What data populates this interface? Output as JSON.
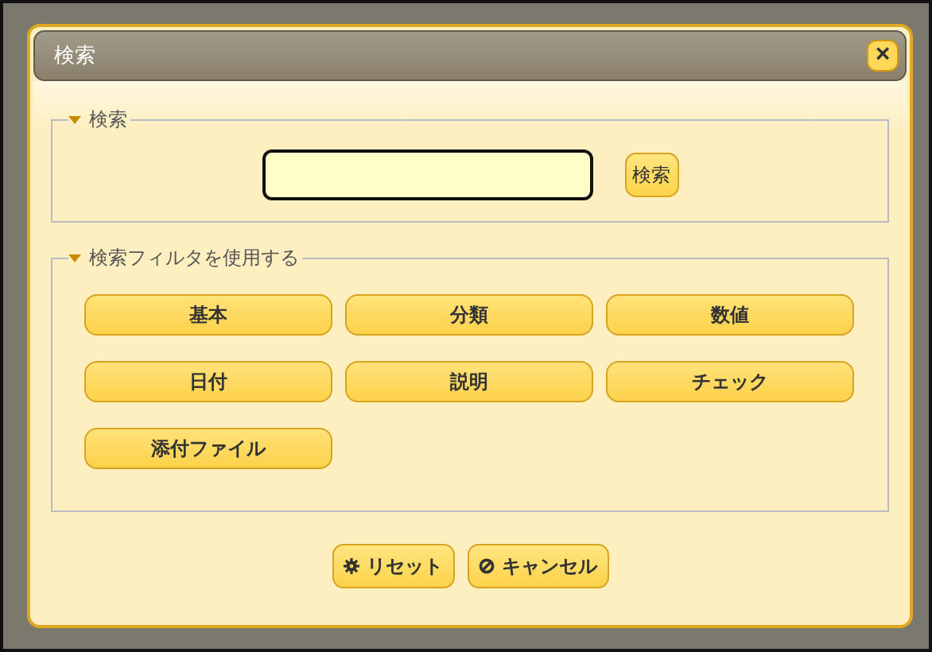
{
  "dialog": {
    "title": "検索",
    "close_icon": "×"
  },
  "search_section": {
    "legend": "検索",
    "expanded": true,
    "button": "検索"
  },
  "filter_section": {
    "legend": "検索フィルタを使用する",
    "expanded": true,
    "buttons": [
      "基本",
      "分類",
      "数値",
      "日付",
      "説明",
      "チェック",
      "添付ファイル"
    ]
  },
  "footer_buttons": [
    {
      "label": "リセット",
      "kind": "reset"
    },
    {
      "label": "キャンセル",
      "kind": "cancel"
    }
  ]
}
